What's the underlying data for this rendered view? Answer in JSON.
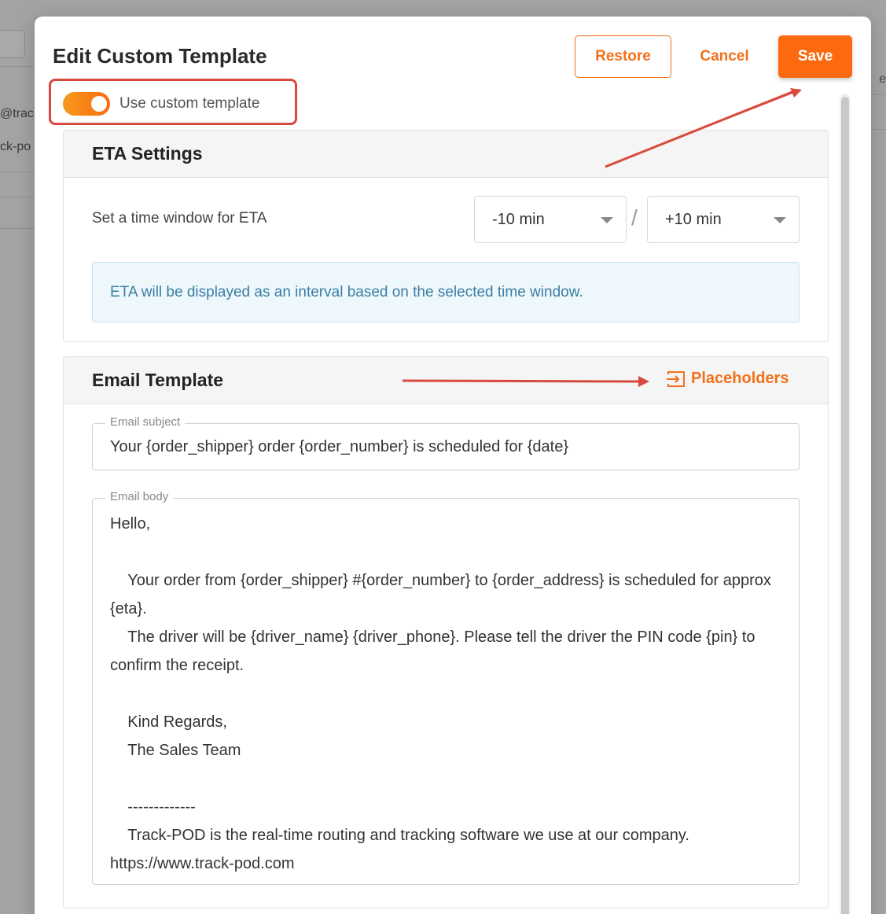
{
  "background": {
    "left_texts": [
      "@track",
      "ck-po"
    ],
    "right_text": "e"
  },
  "modal": {
    "title": "Edit Custom Template",
    "buttons": {
      "restore": "Restore",
      "cancel": "Cancel",
      "save": "Save"
    },
    "toggle": {
      "label": "Use custom template",
      "on": true
    }
  },
  "eta_settings": {
    "header": "ETA Settings",
    "label": "Set a time window for ETA",
    "min_value": "-10 min",
    "separator": "/",
    "max_value": "+10 min",
    "info": "ETA will be displayed as an interval based on the selected time window."
  },
  "email_template": {
    "header": "Email Template",
    "placeholders_label": "Placeholders",
    "subject": {
      "legend": "Email subject",
      "value": "Your {order_shipper} order {order_number} is scheduled for {date}"
    },
    "body": {
      "legend": "Email body",
      "value": "Hello,\n\n    Your order from {order_shipper} #{order_number} to {order_address} is scheduled for approx {eta}.\n    The driver will be {driver_name} {driver_phone}. Please tell the driver the PIN code {pin} to confirm the receipt.\n\n    Kind Regards,\n    The Sales Team\n\n    -------------\n    Track-POD is the real-time routing and tracking software we use at our company.\nhttps://www.track-pod.com"
    }
  },
  "colors": {
    "accent": "#fb6a0f",
    "annotation": "#d94a3e",
    "info_text": "#3a7fa3"
  }
}
